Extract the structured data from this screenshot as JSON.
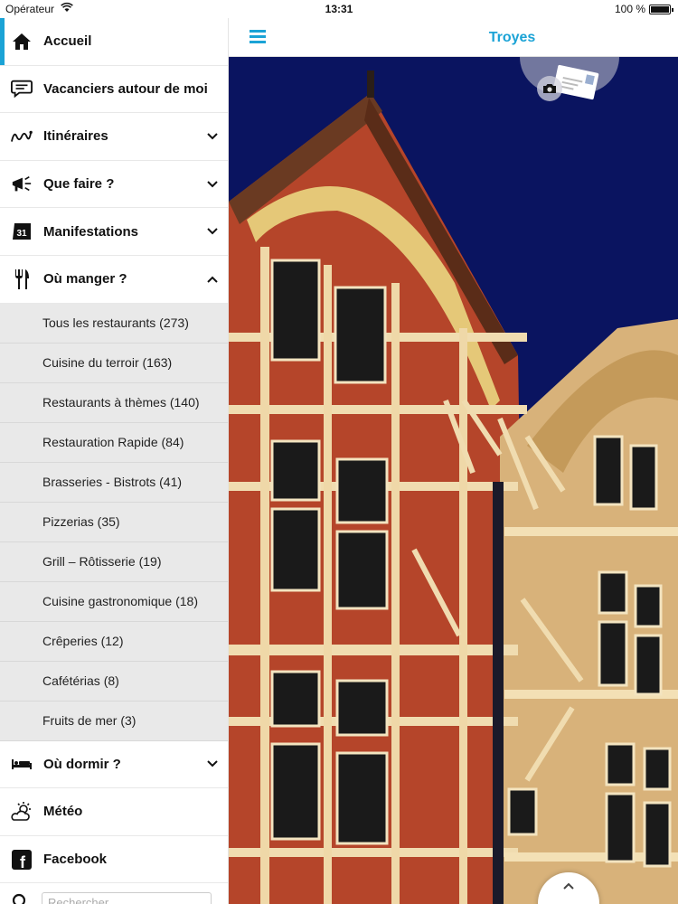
{
  "status_bar": {
    "carrier": "Opérateur",
    "time": "13:31",
    "battery": "100 %"
  },
  "header": {
    "title": "Troyes"
  },
  "sidebar": {
    "items": [
      {
        "label": "Accueil",
        "icon": "home-icon"
      },
      {
        "label": "Vacanciers autour de moi",
        "icon": "chat-icon"
      },
      {
        "label": "Itinéraires",
        "icon": "route-icon"
      },
      {
        "label": "Que faire ?",
        "icon": "megaphone-icon"
      },
      {
        "label": "Manifestations",
        "icon": "calendar-icon"
      },
      {
        "label": "Où manger ?",
        "icon": "fork-knife-icon"
      }
    ],
    "calendar_day": "31",
    "submenu": [
      "Tous les restaurants (273)",
      "Cuisine du terroir (163)",
      "Restaurants à thèmes (140)",
      "Restauration Rapide (84)",
      "Brasseries - Bistrots (41)",
      "Pizzerias (35)",
      "Grill – Rôtisserie (19)",
      "Cuisine gastronomique (18)",
      "Crêperies (12)",
      "Cafétérias (8)",
      "Fruits de mer (3)"
    ],
    "items_after": [
      {
        "label": "Où dormir ?",
        "icon": "bed-icon"
      },
      {
        "label": "Météo",
        "icon": "weather-icon"
      },
      {
        "label": "Facebook",
        "icon": "facebook-icon"
      }
    ],
    "facebook_glyph": "f",
    "search_placeholder": "Rechercher"
  },
  "colors": {
    "accent": "#1ba3d6",
    "sky": "#0a1460"
  }
}
